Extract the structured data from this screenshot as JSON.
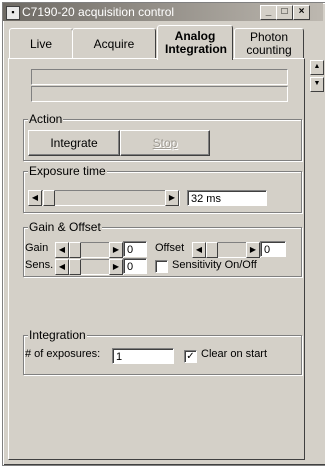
{
  "window": {
    "title": "C7190-20 acquisition control",
    "minimize_glyph": "_",
    "maximize_glyph": "□",
    "close_glyph": "×"
  },
  "tabs": [
    {
      "label": "Live",
      "active": false
    },
    {
      "label": "Acquire",
      "active": false
    },
    {
      "label": "Analog Integration",
      "active": true
    },
    {
      "label": "Photon counting",
      "active": false
    }
  ],
  "action": {
    "group_label": "Action",
    "integrate_label": "Integrate",
    "stop_label": "Stop"
  },
  "exposure": {
    "group_label": "Exposure time",
    "value": "32 ms"
  },
  "gain_offset": {
    "group_label": "Gain & Offset",
    "gain_label": "Gain",
    "gain_value": "0",
    "sens_label": "Sens.",
    "sens_value": "0",
    "offset_label": "Offset",
    "offset_value": "0",
    "sensitivity_label": "Sensitivity On/Off",
    "sensitivity_checked": false
  },
  "integration": {
    "group_label": "Integration",
    "exposures_label": "# of exposures:",
    "exposures_value": "1",
    "clear_label": "Clear on start",
    "clear_checked": true
  },
  "glyphs": {
    "arrow_left": "◀",
    "arrow_right": "▶",
    "arrow_up": "▲",
    "arrow_down": "▼",
    "check": "✓"
  }
}
